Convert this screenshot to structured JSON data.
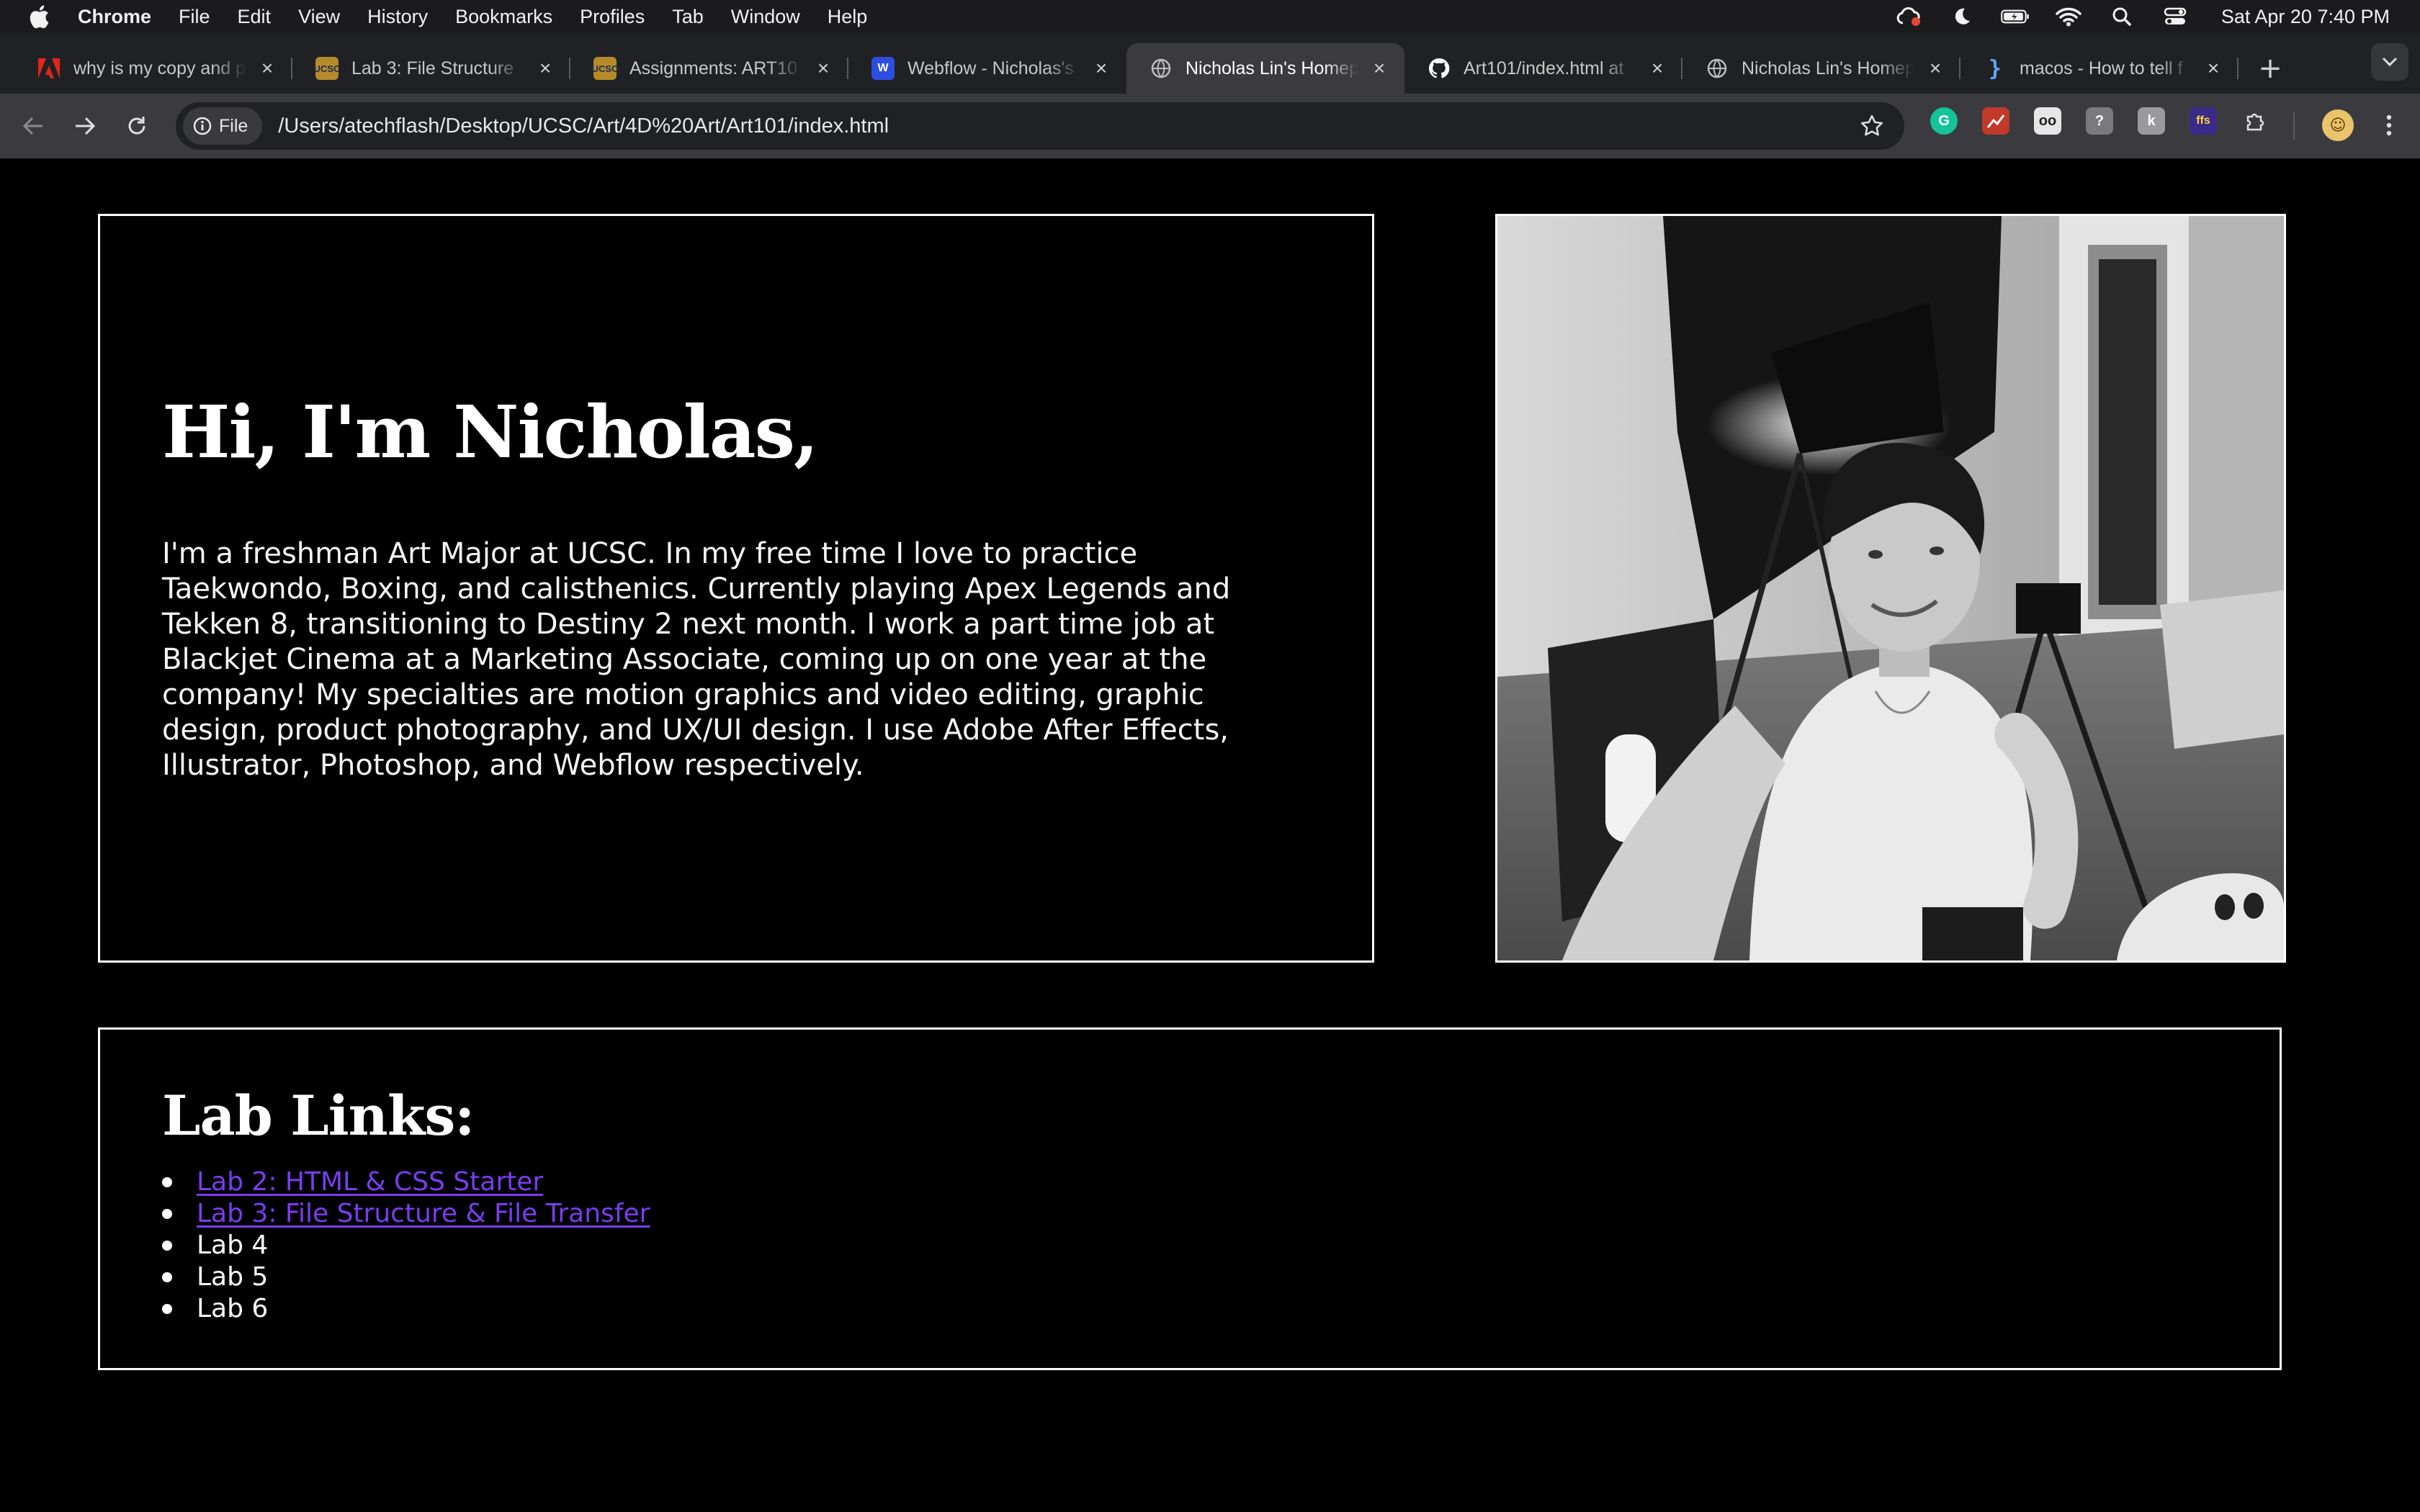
{
  "menubar": {
    "app_name": "Chrome",
    "items": [
      "File",
      "Edit",
      "View",
      "History",
      "Bookmarks",
      "Profiles",
      "Tab",
      "Window",
      "Help"
    ],
    "clock": "Sat Apr 20  7:40 PM"
  },
  "tabs": [
    {
      "title": "why is my copy and p",
      "favicon": "adobe-icon",
      "favicon_color": "#e1251b",
      "active": false
    },
    {
      "title": "Lab 3: File Structure",
      "favicon": "ucsc-icon",
      "favicon_color": "#b58b2a",
      "active": false
    },
    {
      "title": "Assignments: ART10",
      "favicon": "ucsc-icon",
      "favicon_color": "#b58b2a",
      "active": false
    },
    {
      "title": "Webflow - Nicholas's",
      "favicon": "webflow-icon",
      "favicon_color": "#2d4ee0",
      "active": false
    },
    {
      "title": "Nicholas Lin's Homep",
      "favicon": "globe-icon",
      "favicon_color": "#9aa0a6",
      "active": true
    },
    {
      "title": "Art101/index.html at",
      "favicon": "github-icon",
      "favicon_color": "#ffffff",
      "active": false
    },
    {
      "title": "Nicholas Lin's Homep",
      "favicon": "globe-icon",
      "favicon_color": "#9aa0a6",
      "active": false
    },
    {
      "title": "macos - How to tell f",
      "favicon": "code-icon",
      "favicon_color": "#5aa9ff",
      "active": false
    }
  ],
  "toolbar": {
    "site_chip": "File",
    "url": "/Users/atechflash/Desktop/UCSC/Art/4D%20Art/Art101/index.html"
  },
  "page": {
    "heading": "Hi, I'm Nicholas,",
    "bio": "I'm a freshman Art Major at UCSC. In my free time I love to practice Taekwondo, Boxing, and calisthenics. Currently playing Apex Legends and Tekken 8, transitioning to Destiny 2 next month. I work a part time job at Blackjet Cinema at a Marketing Associate, coming up on one year at the company! My specialties are motion graphics and video editing, graphic design, product photography, and UX/UI design. I use Adobe After Effects, Illustrator, Photoshop, and Webflow respectively.",
    "labs_heading": "Lab Links:",
    "labs": [
      {
        "label": "Lab 2: HTML & CSS Starter",
        "is_link": true
      },
      {
        "label": "Lab 3: File Structure & File Transfer",
        "is_link": true
      },
      {
        "label": "Lab 4",
        "is_link": false
      },
      {
        "label": "Lab 5",
        "is_link": false
      },
      {
        "label": "Lab 6",
        "is_link": false
      }
    ],
    "link_color": "#7b3cf0"
  }
}
